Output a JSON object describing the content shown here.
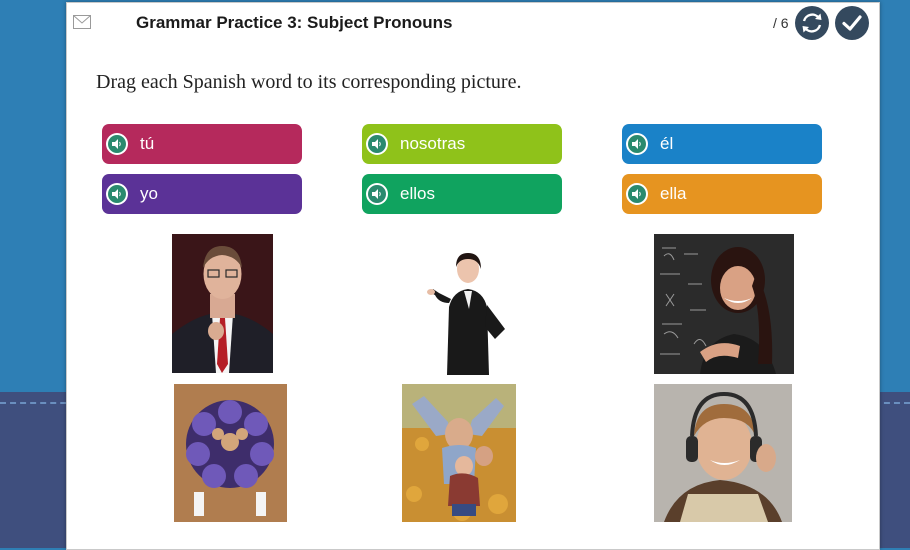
{
  "header": {
    "title": "Grammar Practice 3: Subject Pronouns",
    "counter": "/ 6"
  },
  "instructions": "Drag each Spanish word to its corresponding picture.",
  "chips": [
    {
      "label": "tú",
      "color": "#b5295c"
    },
    {
      "label": "nosotras",
      "color": "#8fc21a"
    },
    {
      "label": "él",
      "color": "#1a82c8"
    },
    {
      "label": "yo",
      "color": "#5b3297"
    },
    {
      "label": "ellos",
      "color": "#10a35f"
    },
    {
      "label": "ella",
      "color": "#e69420"
    }
  ],
  "icons": {
    "mail": "mail-icon",
    "refresh": "refresh-icon",
    "check": "check-icon",
    "speaker": "speaker-icon"
  },
  "colors": {
    "page_bg": "#2e7fb5",
    "lower_bg": "#3f4f7e",
    "button_bg": "#34495e"
  }
}
